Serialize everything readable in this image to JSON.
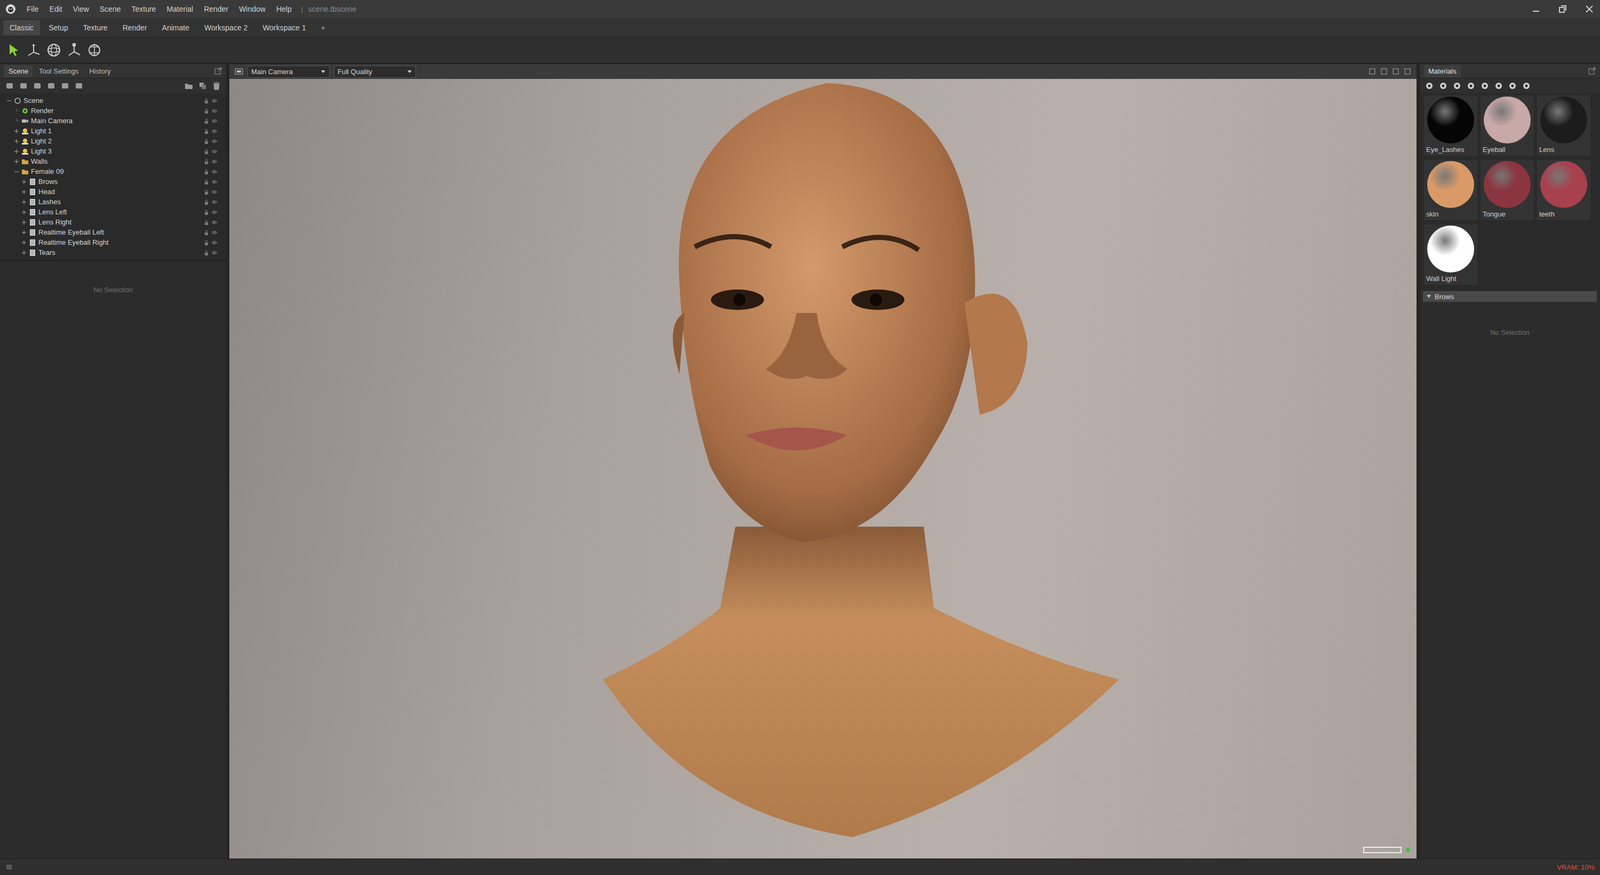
{
  "window": {
    "menu": [
      "File",
      "Edit",
      "View",
      "Scene",
      "Texture",
      "Material",
      "Render",
      "Window",
      "Help"
    ],
    "separator": "|",
    "file": "scene.tbscene"
  },
  "workspace_tabs": [
    {
      "label": "Classic",
      "selected": true
    },
    {
      "label": "Setup",
      "selected": false
    },
    {
      "label": "Texture",
      "selected": false
    },
    {
      "label": "Render",
      "selected": false
    },
    {
      "label": "Animate",
      "selected": false
    },
    {
      "label": "Workspace 2",
      "selected": false
    },
    {
      "label": "Workspace 1",
      "selected": false
    }
  ],
  "add_tab": "+",
  "left_panel": {
    "tabs": [
      {
        "label": "Scene",
        "selected": true
      },
      {
        "label": "Tool Settings",
        "selected": false
      },
      {
        "label": "History",
        "selected": false
      }
    ],
    "tree": [
      {
        "label": "Scene",
        "depth": 0,
        "kind": "scene",
        "children": true,
        "expanded": true
      },
      {
        "label": "Render",
        "depth": 1,
        "kind": "render",
        "children": false,
        "expanded": false
      },
      {
        "label": "Main Camera",
        "depth": 1,
        "kind": "camera",
        "children": false,
        "expanded": false
      },
      {
        "label": "Light 1",
        "depth": 1,
        "kind": "light",
        "children": true,
        "expanded": false
      },
      {
        "label": "Light 2",
        "depth": 1,
        "kind": "light",
        "children": true,
        "expanded": false
      },
      {
        "label": "Light 3",
        "depth": 1,
        "kind": "light",
        "children": true,
        "expanded": false
      },
      {
        "label": "Walls",
        "depth": 1,
        "kind": "folder",
        "children": true,
        "expanded": false
      },
      {
        "label": "Female 09",
        "depth": 1,
        "kind": "folder",
        "children": true,
        "expanded": true
      },
      {
        "label": "Brows",
        "depth": 2,
        "kind": "mesh",
        "children": true,
        "expanded": false
      },
      {
        "label": "Head",
        "depth": 2,
        "kind": "mesh",
        "children": true,
        "expanded": false
      },
      {
        "label": "Lashes",
        "depth": 2,
        "kind": "mesh",
        "children": true,
        "expanded": false
      },
      {
        "label": "Lens Left",
        "depth": 2,
        "kind": "mesh",
        "children": true,
        "expanded": false
      },
      {
        "label": "Lens Right",
        "depth": 2,
        "kind": "mesh",
        "children": true,
        "expanded": false
      },
      {
        "label": "Realtime Eyeball Left",
        "depth": 2,
        "kind": "mesh",
        "children": true,
        "expanded": false
      },
      {
        "label": "Realtime Eyeball Right",
        "depth": 2,
        "kind": "mesh",
        "children": true,
        "expanded": false
      },
      {
        "label": "Tears",
        "depth": 2,
        "kind": "mesh",
        "children": true,
        "expanded": false
      }
    ],
    "properties": "No Selection"
  },
  "viewport": {
    "camera": "Main Camera",
    "quality": "Full Quality"
  },
  "materials": {
    "title": "Materials",
    "items": [
      {
        "name": "Eye_Lashes",
        "color": "#050505"
      },
      {
        "name": "Eyeball",
        "color": "#c9a8a8"
      },
      {
        "name": "Lens",
        "color": "#1c1c1c"
      },
      {
        "name": "skin",
        "color": "#d99a68"
      },
      {
        "name": "Tongue",
        "color": "#8c3440"
      },
      {
        "name": "teeth",
        "color": "#a8404e"
      },
      {
        "name": "Wall Light",
        "color": "#ffffff"
      }
    ],
    "group": "Brows",
    "properties": "No Selection"
  },
  "status_bar": {
    "vram": "VRAM: 10%"
  }
}
